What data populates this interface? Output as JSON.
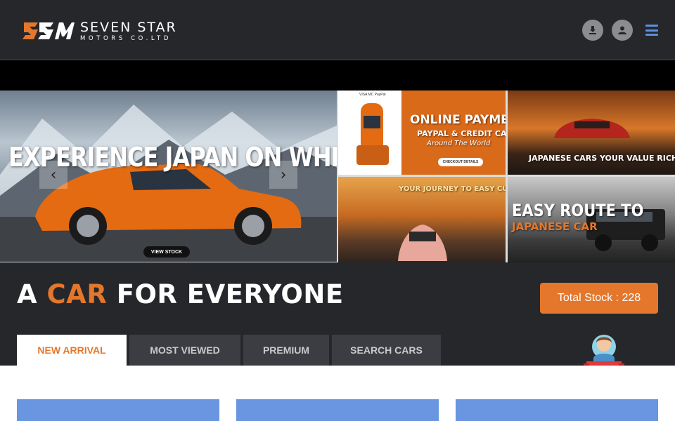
{
  "brand": {
    "name": "SEVEN STAR",
    "sub": "MOTORS CO.LTD",
    "mark": "SSM"
  },
  "header": {
    "icons": [
      "download-icon",
      "user-icon",
      "menu-icon"
    ]
  },
  "banner": {
    "main": {
      "title": "EXPERIENCE JAPAN ON WHEELS",
      "cta": "VIEW STOCK",
      "prev": "‹",
      "next": "›"
    },
    "tiles": [
      {
        "line1": "ONLINE PAYMENTS",
        "line2": "PAYPAL & CREDIT CARD",
        "line3": "Around The World",
        "cta": "CHECKOUT DETAILS",
        "cards": "VISA  MC  PayPal"
      },
      {
        "title": "JAPANESE CARS YOUR VALUE RICH"
      },
      {
        "title": "YOUR JOURNEY TO EASY CUSTOM"
      },
      {
        "line1": "EASY ROUTE TO",
        "line2": "JAPANESE CAR"
      }
    ]
  },
  "headline": {
    "part1": "A ",
    "accent": "CAR",
    "part2": " FOR EVERYONE"
  },
  "stock": {
    "label": "Total Stock : 228"
  },
  "tabs": [
    {
      "label": "NEW ARRIVAL",
      "active": true
    },
    {
      "label": "MOST VIEWED",
      "active": false
    },
    {
      "label": "PREMIUM",
      "active": false
    },
    {
      "label": "SEARCH CARS",
      "active": false
    }
  ],
  "colors": {
    "accent": "#e4772b",
    "header_bg": "#25272b",
    "card": "#6a95e0",
    "menu": "#5b8fe0"
  }
}
